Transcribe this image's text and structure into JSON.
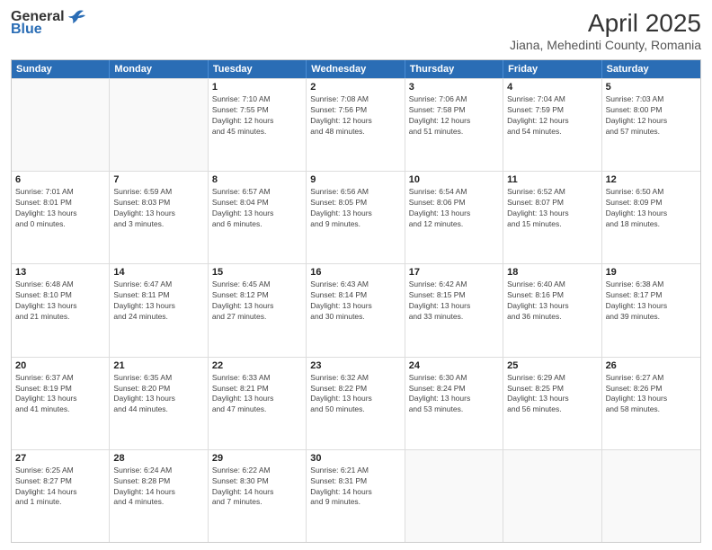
{
  "header": {
    "logo": {
      "general": "General",
      "blue": "Blue"
    },
    "title": "April 2025",
    "subtitle": "Jiana, Mehedinti County, Romania"
  },
  "calendar": {
    "days": [
      "Sunday",
      "Monday",
      "Tuesday",
      "Wednesday",
      "Thursday",
      "Friday",
      "Saturday"
    ],
    "weeks": [
      [
        {
          "day": "",
          "info": ""
        },
        {
          "day": "",
          "info": ""
        },
        {
          "day": "1",
          "info": "Sunrise: 7:10 AM\nSunset: 7:55 PM\nDaylight: 12 hours\nand 45 minutes."
        },
        {
          "day": "2",
          "info": "Sunrise: 7:08 AM\nSunset: 7:56 PM\nDaylight: 12 hours\nand 48 minutes."
        },
        {
          "day": "3",
          "info": "Sunrise: 7:06 AM\nSunset: 7:58 PM\nDaylight: 12 hours\nand 51 minutes."
        },
        {
          "day": "4",
          "info": "Sunrise: 7:04 AM\nSunset: 7:59 PM\nDaylight: 12 hours\nand 54 minutes."
        },
        {
          "day": "5",
          "info": "Sunrise: 7:03 AM\nSunset: 8:00 PM\nDaylight: 12 hours\nand 57 minutes."
        }
      ],
      [
        {
          "day": "6",
          "info": "Sunrise: 7:01 AM\nSunset: 8:01 PM\nDaylight: 13 hours\nand 0 minutes."
        },
        {
          "day": "7",
          "info": "Sunrise: 6:59 AM\nSunset: 8:03 PM\nDaylight: 13 hours\nand 3 minutes."
        },
        {
          "day": "8",
          "info": "Sunrise: 6:57 AM\nSunset: 8:04 PM\nDaylight: 13 hours\nand 6 minutes."
        },
        {
          "day": "9",
          "info": "Sunrise: 6:56 AM\nSunset: 8:05 PM\nDaylight: 13 hours\nand 9 minutes."
        },
        {
          "day": "10",
          "info": "Sunrise: 6:54 AM\nSunset: 8:06 PM\nDaylight: 13 hours\nand 12 minutes."
        },
        {
          "day": "11",
          "info": "Sunrise: 6:52 AM\nSunset: 8:07 PM\nDaylight: 13 hours\nand 15 minutes."
        },
        {
          "day": "12",
          "info": "Sunrise: 6:50 AM\nSunset: 8:09 PM\nDaylight: 13 hours\nand 18 minutes."
        }
      ],
      [
        {
          "day": "13",
          "info": "Sunrise: 6:48 AM\nSunset: 8:10 PM\nDaylight: 13 hours\nand 21 minutes."
        },
        {
          "day": "14",
          "info": "Sunrise: 6:47 AM\nSunset: 8:11 PM\nDaylight: 13 hours\nand 24 minutes."
        },
        {
          "day": "15",
          "info": "Sunrise: 6:45 AM\nSunset: 8:12 PM\nDaylight: 13 hours\nand 27 minutes."
        },
        {
          "day": "16",
          "info": "Sunrise: 6:43 AM\nSunset: 8:14 PM\nDaylight: 13 hours\nand 30 minutes."
        },
        {
          "day": "17",
          "info": "Sunrise: 6:42 AM\nSunset: 8:15 PM\nDaylight: 13 hours\nand 33 minutes."
        },
        {
          "day": "18",
          "info": "Sunrise: 6:40 AM\nSunset: 8:16 PM\nDaylight: 13 hours\nand 36 minutes."
        },
        {
          "day": "19",
          "info": "Sunrise: 6:38 AM\nSunset: 8:17 PM\nDaylight: 13 hours\nand 39 minutes."
        }
      ],
      [
        {
          "day": "20",
          "info": "Sunrise: 6:37 AM\nSunset: 8:19 PM\nDaylight: 13 hours\nand 41 minutes."
        },
        {
          "day": "21",
          "info": "Sunrise: 6:35 AM\nSunset: 8:20 PM\nDaylight: 13 hours\nand 44 minutes."
        },
        {
          "day": "22",
          "info": "Sunrise: 6:33 AM\nSunset: 8:21 PM\nDaylight: 13 hours\nand 47 minutes."
        },
        {
          "day": "23",
          "info": "Sunrise: 6:32 AM\nSunset: 8:22 PM\nDaylight: 13 hours\nand 50 minutes."
        },
        {
          "day": "24",
          "info": "Sunrise: 6:30 AM\nSunset: 8:24 PM\nDaylight: 13 hours\nand 53 minutes."
        },
        {
          "day": "25",
          "info": "Sunrise: 6:29 AM\nSunset: 8:25 PM\nDaylight: 13 hours\nand 56 minutes."
        },
        {
          "day": "26",
          "info": "Sunrise: 6:27 AM\nSunset: 8:26 PM\nDaylight: 13 hours\nand 58 minutes."
        }
      ],
      [
        {
          "day": "27",
          "info": "Sunrise: 6:25 AM\nSunset: 8:27 PM\nDaylight: 14 hours\nand 1 minute."
        },
        {
          "day": "28",
          "info": "Sunrise: 6:24 AM\nSunset: 8:28 PM\nDaylight: 14 hours\nand 4 minutes."
        },
        {
          "day": "29",
          "info": "Sunrise: 6:22 AM\nSunset: 8:30 PM\nDaylight: 14 hours\nand 7 minutes."
        },
        {
          "day": "30",
          "info": "Sunrise: 6:21 AM\nSunset: 8:31 PM\nDaylight: 14 hours\nand 9 minutes."
        },
        {
          "day": "",
          "info": ""
        },
        {
          "day": "",
          "info": ""
        },
        {
          "day": "",
          "info": ""
        }
      ]
    ]
  }
}
